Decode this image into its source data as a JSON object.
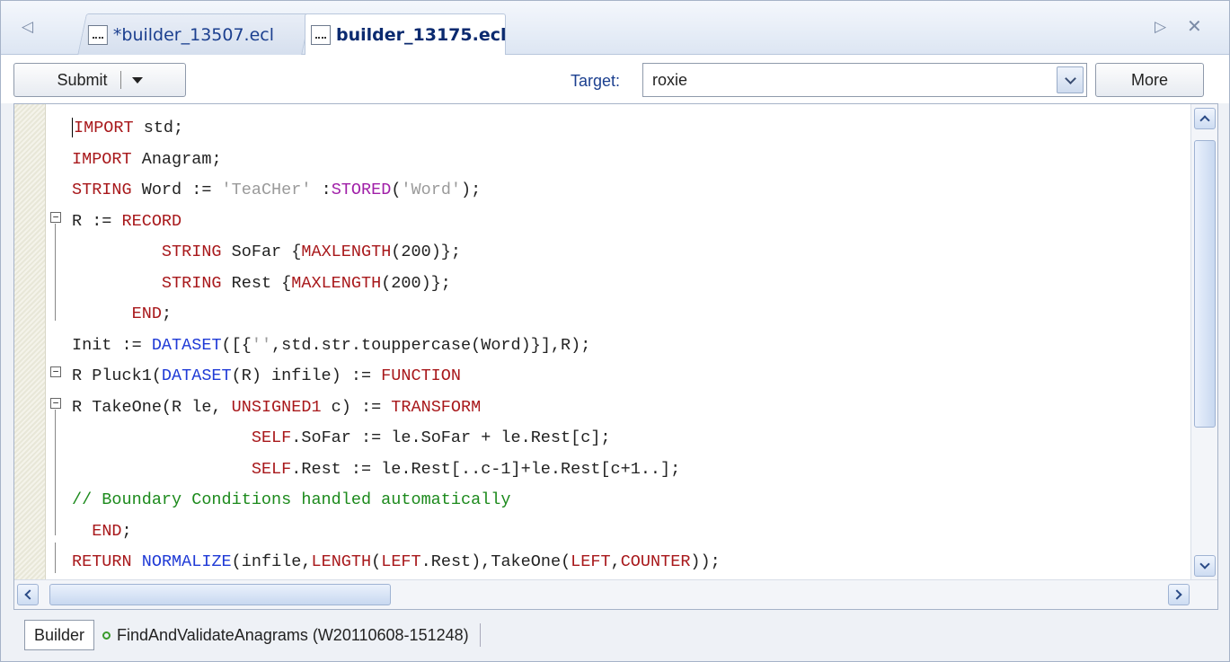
{
  "tabs": {
    "nav_left": "◁",
    "nav_right": "▷",
    "close": "✕",
    "inactive_label": "*builder_13507.ecl",
    "active_label": "builder_13175.ecl"
  },
  "toolbar": {
    "submit_label": "Submit",
    "target_label": "Target:",
    "target_value": "roxie",
    "more_label": "More"
  },
  "editor": {
    "lines": [
      [
        {
          "t": "IMPORT",
          "c": "kw"
        },
        {
          "t": " std;"
        }
      ],
      [
        {
          "t": "IMPORT",
          "c": "kw"
        },
        {
          "t": " Anagram;"
        }
      ],
      [
        {
          "t": "STRING",
          "c": "kw"
        },
        {
          "t": " Word := "
        },
        {
          "t": "'TeaCHer'",
          "c": "str"
        },
        {
          "t": " :"
        },
        {
          "t": "STORED",
          "c": "mg"
        },
        {
          "t": "("
        },
        {
          "t": "'Word'",
          "c": "str"
        },
        {
          "t": ");"
        }
      ],
      [
        {
          "t": "R := "
        },
        {
          "t": "RECORD",
          "c": "kw"
        }
      ],
      [
        {
          "t": "         "
        },
        {
          "t": "STRING",
          "c": "kw"
        },
        {
          "t": " SoFar {"
        },
        {
          "t": "MAXLENGTH",
          "c": "kw"
        },
        {
          "t": "(200)};"
        }
      ],
      [
        {
          "t": "         "
        },
        {
          "t": "STRING",
          "c": "kw"
        },
        {
          "t": " Rest {"
        },
        {
          "t": "MAXLENGTH",
          "c": "kw"
        },
        {
          "t": "(200)};"
        }
      ],
      [
        {
          "t": "      "
        },
        {
          "t": "END",
          "c": "kw"
        },
        {
          "t": ";"
        }
      ],
      [
        {
          "t": "Init := "
        },
        {
          "t": "DATASET",
          "c": "fn"
        },
        {
          "t": "([{"
        },
        {
          "t": "''",
          "c": "str"
        },
        {
          "t": ",std.str.touppercase(Word)}],R);"
        }
      ],
      [
        {
          "t": "R Pluck1("
        },
        {
          "t": "DATASET",
          "c": "fn"
        },
        {
          "t": "(R) infile) := "
        },
        {
          "t": "FUNCTION",
          "c": "kw"
        }
      ],
      [
        {
          "t": "R TakeOne(R le, "
        },
        {
          "t": "UNSIGNED1",
          "c": "kw"
        },
        {
          "t": " c) := "
        },
        {
          "t": "TRANSFORM",
          "c": "kw"
        }
      ],
      [
        {
          "t": "                  "
        },
        {
          "t": "SELF",
          "c": "kw"
        },
        {
          "t": ".SoFar := le.SoFar + le.Rest[c];"
        }
      ],
      [
        {
          "t": "                  "
        },
        {
          "t": "SELF",
          "c": "kw"
        },
        {
          "t": ".Rest := le.Rest[..c-1]+le.Rest[c+1..];"
        }
      ],
      [
        {
          "t": "// Boundary Conditions handled automatically",
          "c": "cm"
        }
      ],
      [
        {
          "t": "  "
        },
        {
          "t": "END",
          "c": "kw"
        },
        {
          "t": ";"
        }
      ],
      [
        {
          "t": "RETURN",
          "c": "kw"
        },
        {
          "t": " "
        },
        {
          "t": "NORMALIZE",
          "c": "fn"
        },
        {
          "t": "(infile,"
        },
        {
          "t": "LENGTH",
          "c": "kw"
        },
        {
          "t": "("
        },
        {
          "t": "LEFT",
          "c": "kw"
        },
        {
          "t": ".Rest),TakeOne("
        },
        {
          "t": "LEFT",
          "c": "kw"
        },
        {
          "t": ","
        },
        {
          "t": "COUNTER",
          "c": "kw"
        },
        {
          "t": "));"
        }
      ]
    ]
  },
  "statusbar": {
    "builder_label": "Builder",
    "workunit_label": "FindAndValidateAnagrams (W20110608-151248)"
  },
  "colors": {
    "keyword": "#a8181b",
    "function": "#1f3ad6",
    "string": "#9a9a9a",
    "stored": "#a01fa8",
    "comment": "#1c8a1c"
  }
}
